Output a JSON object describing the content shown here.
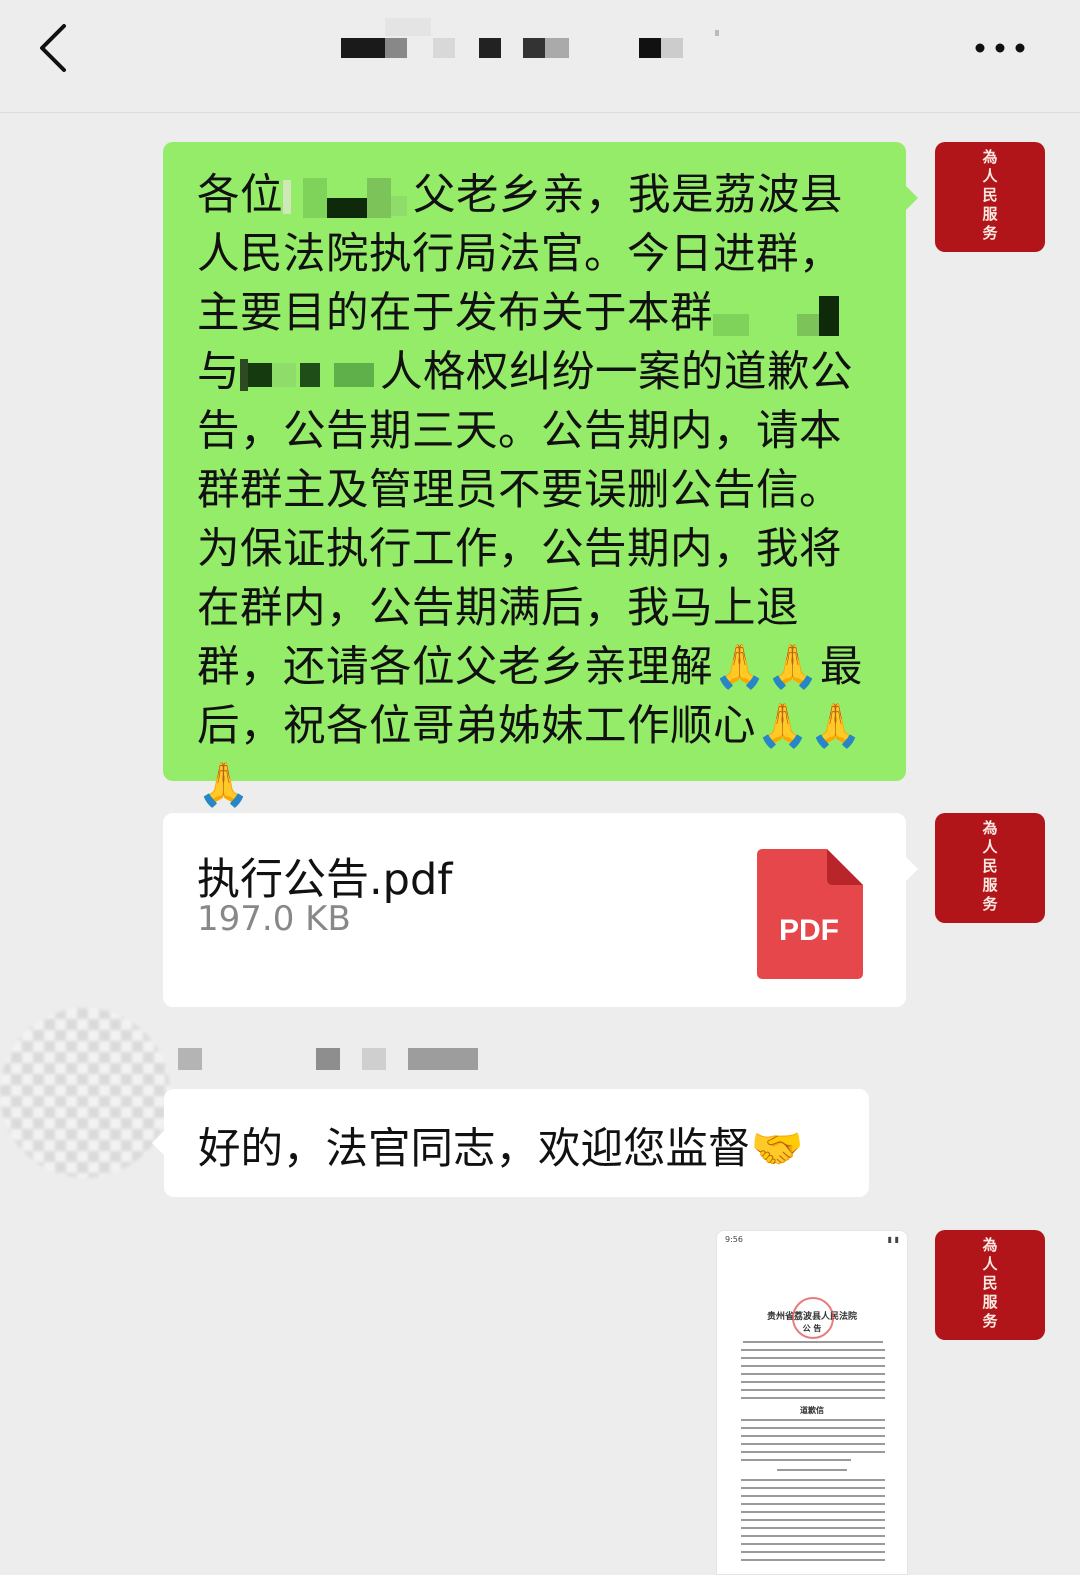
{
  "header": {
    "back_icon": "chevron-left-icon",
    "title_redacted": true,
    "more_icon": "more-horizontal-icon"
  },
  "self_avatar": {
    "stamp_text": [
      "為",
      "人",
      "民",
      "服",
      "务"
    ],
    "color": "#b1151a"
  },
  "messages": [
    {
      "type": "text",
      "side": "right",
      "bubble_color": "#95ec69",
      "segments": [
        "各位",
        "父老乡亲，我是荔波县人民法院执行局法官。今日进群，主要目的在于发布关于本群",
        "与",
        "人格权纠纷一案的道歉公告，公告期三天。公告期内，请本群群主及管理员不要误删公告信。为保证执行工作，公告期内，我将在群内，公告期满后，我马上退群，还请各位父老乡亲理解🙏🙏最后，祝各位哥弟姊妹工作顺心🙏🙏🙏"
      ]
    },
    {
      "type": "file",
      "side": "right",
      "file_name": "执行公告.pdf",
      "file_size": "197.0 KB",
      "icon_label": "PDF",
      "icon_color": "#e5474b"
    },
    {
      "type": "text",
      "side": "left",
      "sender_redacted": true,
      "text": "好的，法官同志，欢迎您监督🤝"
    },
    {
      "type": "image",
      "side": "right",
      "status_time": "9:56",
      "doc_title": "贵州省荔波县人民法院",
      "doc_subtitle": "公 告",
      "doc_heading": "道歉信"
    }
  ]
}
